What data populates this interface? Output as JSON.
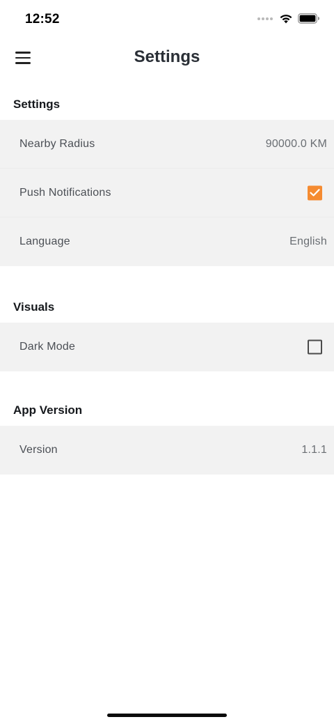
{
  "status_bar": {
    "time": "12:52"
  },
  "header": {
    "title": "Settings",
    "menu_icon": "hamburger-menu-icon"
  },
  "sections": {
    "settings": {
      "title": "Settings",
      "nearby_radius": {
        "label": "Nearby Radius",
        "value": "90000.0 KM"
      },
      "push_notifications": {
        "label": "Push Notifications",
        "checked": true
      },
      "language": {
        "label": "Language",
        "value": "English"
      }
    },
    "visuals": {
      "title": "Visuals",
      "dark_mode": {
        "label": "Dark Mode",
        "checked": false
      }
    },
    "app_version": {
      "title": "App Version",
      "version": {
        "label": "Version",
        "value": "1.1.1"
      }
    }
  },
  "colors": {
    "accent": "#f58b31",
    "row_background": "#f2f2f2"
  }
}
